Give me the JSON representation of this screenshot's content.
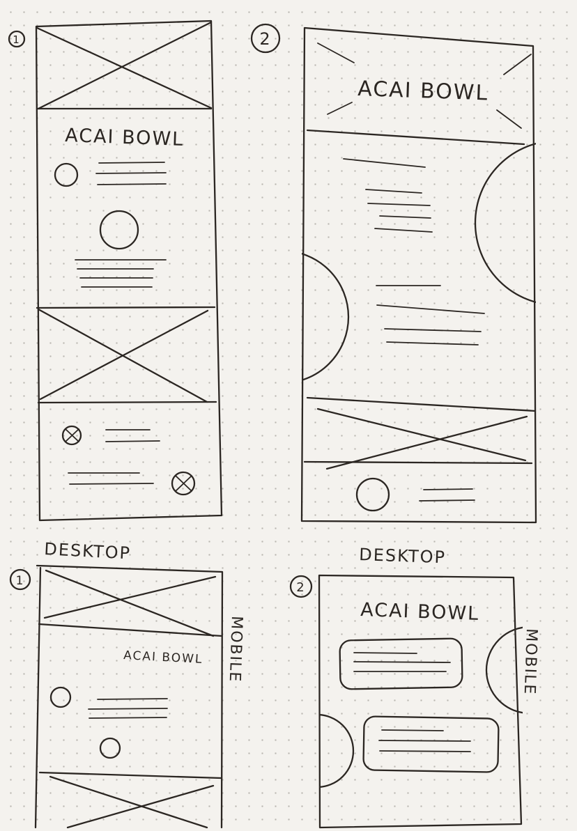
{
  "sketch1": {
    "number": "1",
    "title": "ACAI BOWL",
    "caption": "DESKTOP"
  },
  "sketch2": {
    "number": "2",
    "title": "ACAI BOWL",
    "caption": "DESKTOP"
  },
  "sketch3": {
    "number": "1",
    "title": "ACAI BOWL",
    "caption": "MOBILE"
  },
  "sketch4": {
    "number": "2",
    "title": "ACAI BOWL",
    "caption": "MOBILE"
  },
  "colors": {
    "paper": "#f4f2ee",
    "ink": "#2b2622",
    "dots": "#b9b6b0"
  }
}
